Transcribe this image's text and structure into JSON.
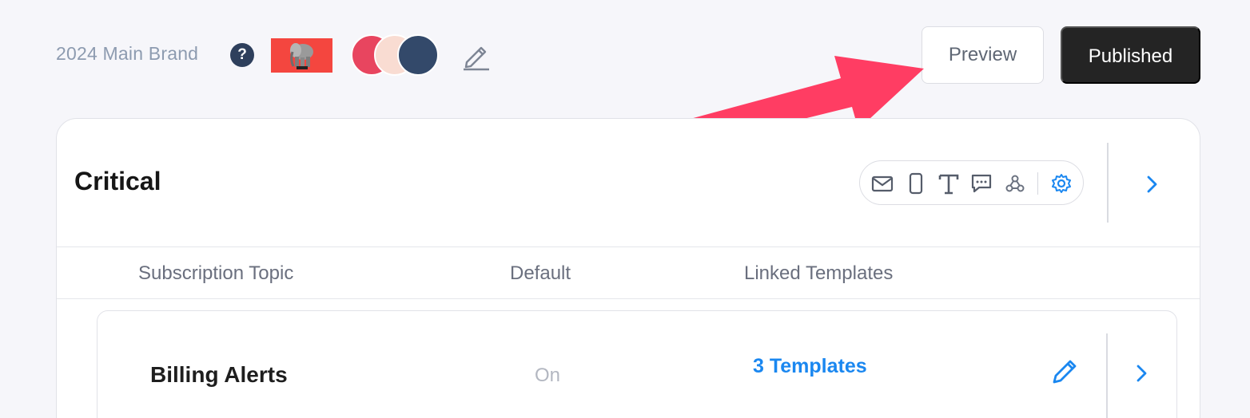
{
  "brand": {
    "name": "2024 Main Brand",
    "help_glyph": "?",
    "logo": "elephant-logo",
    "colors": [
      "#e8455f",
      "#f9dcd2",
      "#33496a"
    ]
  },
  "actions": {
    "preview_label": "Preview",
    "published_label": "Published"
  },
  "annotation": {
    "arrow_color": "#ff3d63",
    "points_to": "preview-button"
  },
  "category": {
    "title": "Critical",
    "channels": [
      "email-icon",
      "push-icon",
      "sms-icon",
      "chat-icon",
      "webhook-icon",
      "settings-icon"
    ]
  },
  "table": {
    "columns": [
      "Subscription Topic",
      "Default",
      "Linked Templates"
    ],
    "rows": [
      {
        "topic": "Billing Alerts",
        "default": "On",
        "templates": "3 Templates"
      }
    ]
  },
  "accent": "#1a87f0"
}
